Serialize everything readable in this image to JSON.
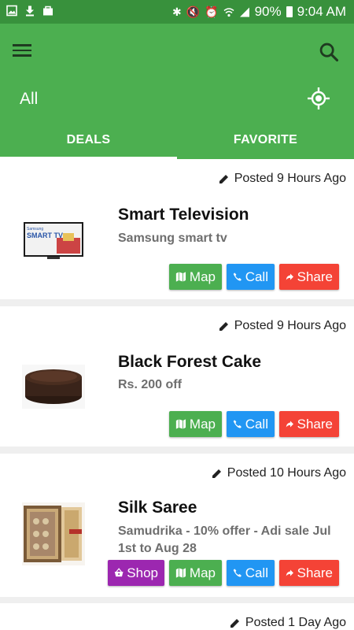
{
  "status_bar": {
    "battery": "90%",
    "time": "9:04 AM"
  },
  "appbar": {
    "location": "All"
  },
  "tabs": [
    {
      "label": "DEALS"
    },
    {
      "label": "FAVORITE"
    }
  ],
  "buttons": {
    "shop": "Shop",
    "map": "Map",
    "call": "Call",
    "share": "Share"
  },
  "deals": [
    {
      "posted": "Posted 9 Hours Ago",
      "title": "Smart Television",
      "subtitle": "Samsung smart tv",
      "thumb_text_top": "Samsung",
      "thumb_text_main": "SMART TV"
    },
    {
      "posted": "Posted 9 Hours Ago",
      "title": "Black Forest Cake",
      "subtitle": "Rs. 200 off"
    },
    {
      "posted": "Posted 10 Hours Ago",
      "title": "Silk Saree",
      "subtitle": "Samudrika - 10% offer - Adi sale Jul 1st to Aug 28"
    },
    {
      "posted": "Posted 1 Day Ago"
    }
  ],
  "colors": {
    "primary": "#4caf50",
    "status_bar": "#38913c",
    "map": "#4caf50",
    "call": "#2196f3",
    "share": "#f44336",
    "shop": "#9c27b0"
  }
}
